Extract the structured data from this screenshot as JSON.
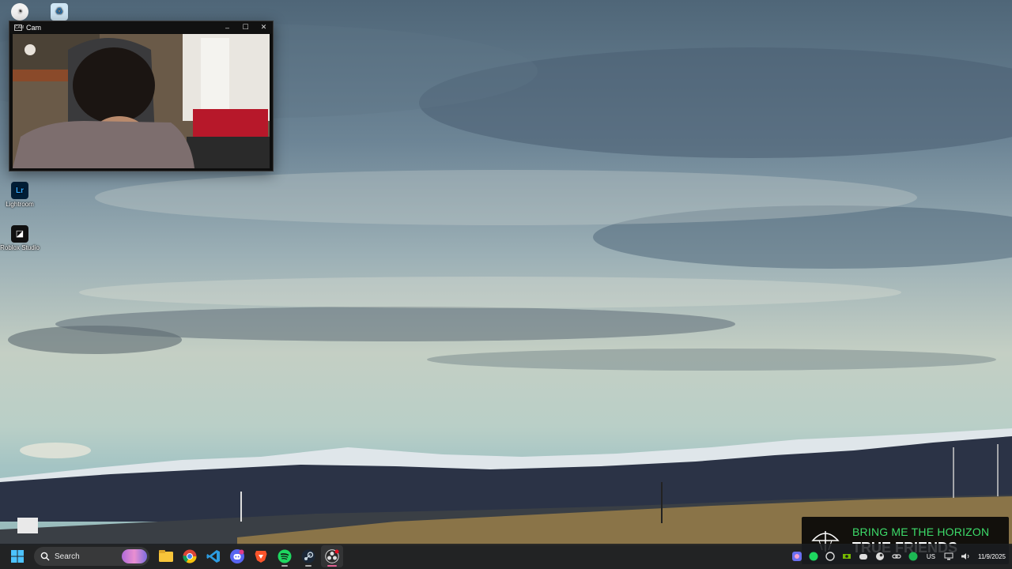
{
  "desktop": {
    "icons": [
      {
        "label": "Lightroom",
        "icon": "lightroom-icon"
      },
      {
        "label": "Roblox Studio",
        "icon": "roblox-studio-icon"
      }
    ],
    "top_icons": [
      "brave-browser-icon",
      "recycle-bin-icon"
    ]
  },
  "cam_window": {
    "title": "Cam",
    "minimize": "–",
    "maximize": "☐",
    "close": "✕"
  },
  "now_playing": {
    "artist": "BRING ME THE HORIZON",
    "track": "TRUE FRIENDS",
    "accent": "#3ddc6a"
  },
  "taskbar": {
    "search_label": "Search",
    "pinned": [
      "file-explorer-icon",
      "chrome-icon",
      "vscode-icon",
      "discord-icon",
      "brave-icon",
      "spotify-icon",
      "steam-icon",
      "obs-icon"
    ],
    "tray_icons": [
      "copilot-icon",
      "spotify-tray-icon",
      "github-icon",
      "nvidia-icon",
      "discord-tray-icon",
      "steam-tray-icon",
      "link-icon",
      "spotify-green-icon"
    ],
    "language": "US",
    "date": "11/9/2025"
  }
}
